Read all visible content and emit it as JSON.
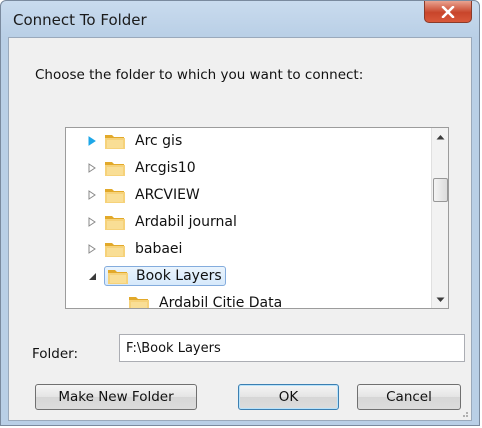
{
  "window": {
    "title": "Connect To Folder",
    "close_icon": "close-x-icon"
  },
  "prompt": "Choose the folder to which you want to connect:",
  "tree": {
    "items": [
      {
        "label": "Arc gis",
        "expander": "collapsed",
        "expander_highlight": true,
        "selected": false,
        "level": 0
      },
      {
        "label": "Arcgis10",
        "expander": "collapsed",
        "expander_highlight": false,
        "selected": false,
        "level": 0
      },
      {
        "label": "ARCVIEW",
        "expander": "collapsed",
        "expander_highlight": false,
        "selected": false,
        "level": 0
      },
      {
        "label": "Ardabil journal",
        "expander": "collapsed",
        "expander_highlight": false,
        "selected": false,
        "level": 0
      },
      {
        "label": "babaei",
        "expander": "collapsed",
        "expander_highlight": false,
        "selected": false,
        "level": 0
      },
      {
        "label": "Book Layers",
        "expander": "expanded",
        "expander_highlight": false,
        "selected": true,
        "level": 0
      },
      {
        "label": "Ardabil Citie Data",
        "expander": "none",
        "expander_highlight": false,
        "selected": false,
        "level": 1
      }
    ],
    "icon": "folder-icon"
  },
  "folder": {
    "label": "Folder:",
    "value": "F:\\Book Layers"
  },
  "buttons": {
    "make_new_folder": "Make New Folder",
    "ok": "OK",
    "cancel": "Cancel"
  },
  "colors": {
    "titlebar": "#c9dbee",
    "close": "#c8452b",
    "selection": "#d6e9fb",
    "folder": "#e9b93c"
  }
}
